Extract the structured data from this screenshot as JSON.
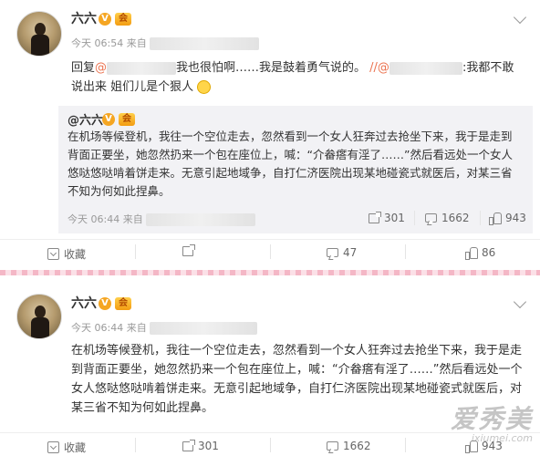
{
  "post1": {
    "username": "六六",
    "v_badge": "V",
    "member_badge": "会",
    "time": "今天 06:54 来自",
    "reply_prefix": "回复",
    "reply_at": "@",
    "reply_text1": "我也很怕啊……我是鼓着勇气说的。",
    "reply_sep": "//@",
    "reply_text2": ":我都不敢",
    "reply_line2": "说出来 姐们儿是个狠人",
    "quote": {
      "author": "@六六",
      "v_badge": "V",
      "member_badge": "会",
      "text": "在机场等候登机，我往一个空位走去，忽然看到一个女人狂奔过去抢坐下来，我于是走到背面正要坐，她忽然扔来一个包在座位上，喊：“介畚瘩有淫了……”然后看远处一个女人悠哒悠哒啃着饼走来。无意引起地域争，自打仁济医院出现某地碰瓷式就医后，对某三省不知为何如此捏鼻。",
      "time": "今天 06:44 来自",
      "forward_count": "301",
      "comment_count": "1662",
      "like_count": "943"
    },
    "actions": {
      "favorite_label": "收藏",
      "forward_count": "",
      "comment_count": "47",
      "like_count": "86"
    }
  },
  "post2": {
    "username": "六六",
    "v_badge": "V",
    "member_badge": "会",
    "time": "今天 06:44 来自",
    "text": "在机场等候登机，我往一个空位走去，忽然看到一个女人狂奔过去抢坐下来，我于是走到背面正要坐，她忽然扔来一个包在座位上，喊：“介畚瘩有淫了……”然后看远处一个女人悠哒悠哒啃着饼走来。无意引起地域争，自打仁济医院出现某地碰瓷式就医后，对某三省不知为何如此捏鼻。",
    "actions": {
      "favorite_label": "收藏",
      "forward_count": "301",
      "comment_count": "1662",
      "like_count": "943"
    }
  },
  "watermark": {
    "big": "爱秀美",
    "small": "ixiumei.com"
  },
  "colors": {
    "link": "#eb7350",
    "divider": "#f4b7c6",
    "quote_bg": "#f2f2f5"
  }
}
